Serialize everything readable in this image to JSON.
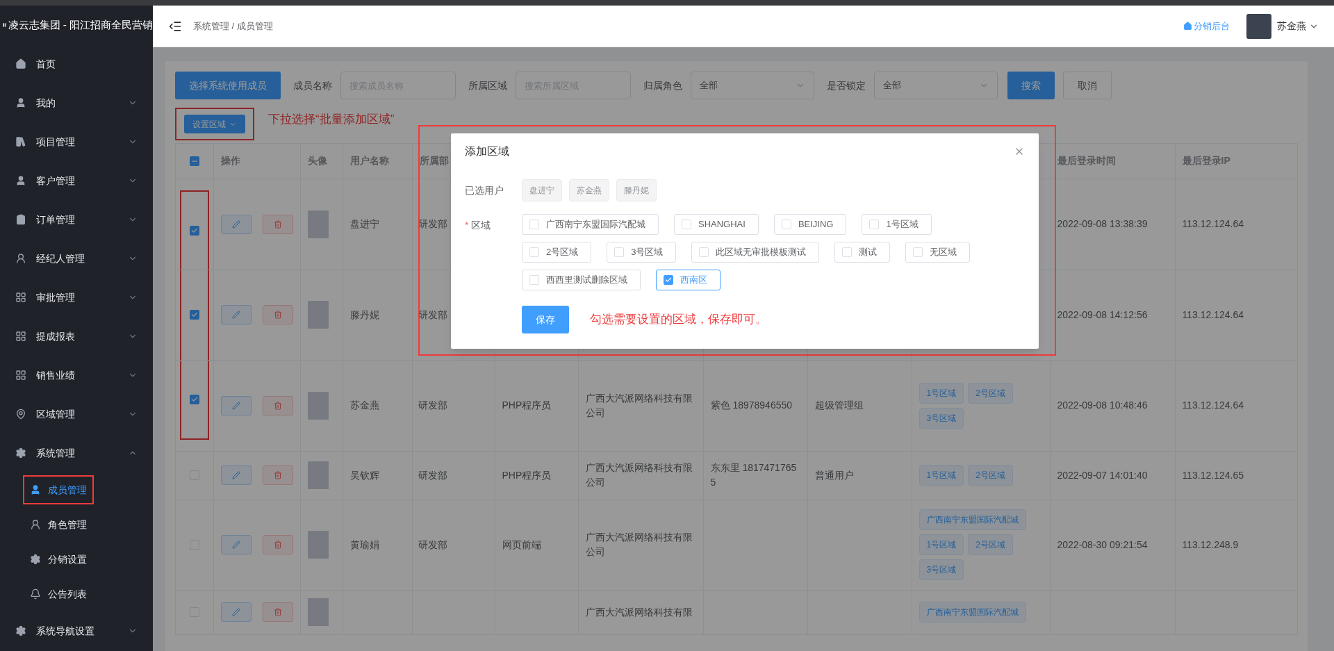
{
  "sidebar": {
    "brand": "凌云志集团 - 阳江招商全民营销",
    "items": [
      {
        "label": "首页"
      },
      {
        "label": "我的",
        "expanded": false
      },
      {
        "label": "项目管理",
        "expanded": false
      },
      {
        "label": "客户管理",
        "expanded": false
      },
      {
        "label": "订单管理",
        "expanded": false
      },
      {
        "label": "经纪人管理",
        "expanded": false
      },
      {
        "label": "审批管理",
        "expanded": false
      },
      {
        "label": "提成报表",
        "expanded": false
      },
      {
        "label": "销售业绩",
        "expanded": false
      },
      {
        "label": "区域管理",
        "expanded": false
      },
      {
        "label": "系统管理",
        "expanded": true,
        "children": [
          {
            "label": "成员管理",
            "selected": true,
            "highlighted": true
          },
          {
            "label": "角色管理",
            "selected": false,
            "highlighted": false
          },
          {
            "label": "分销设置",
            "selected": false,
            "highlighted": false
          },
          {
            "label": "公告列表",
            "selected": false,
            "highlighted": false
          }
        ]
      },
      {
        "label": "系统导航设置",
        "expanded": false
      }
    ]
  },
  "header": {
    "breadcrumb": "系统管理 / 成员管理",
    "link": "分销后台",
    "user": "苏金燕"
  },
  "filters": {
    "primary_button": "选择系统使用成员",
    "fields": [
      {
        "kind": "input",
        "label": "成员名称",
        "placeholder": "搜索成员名称"
      },
      {
        "kind": "input",
        "label": "所属区域",
        "placeholder": "搜索所属区域"
      },
      {
        "kind": "select",
        "label": "归属角色",
        "value": "全部"
      },
      {
        "kind": "select",
        "label": "是否锁定",
        "value": "全部"
      }
    ],
    "search_button": "搜索",
    "cancel_button": "取消"
  },
  "set_region": {
    "label": "设置区域",
    "highlighted": true,
    "note": "下拉选择“批量添加区域”"
  },
  "table": {
    "all_indeterminate": true,
    "columns": [
      "操作",
      "头像",
      "用户名称",
      "所属部",
      "",
      "",
      "",
      "",
      "",
      "最后登录时间",
      "最后登录IP"
    ],
    "rows": [
      {
        "checked": true,
        "highlighted": true,
        "name": "盘进宁",
        "dept": "研发部",
        "time": "2022-09-08 13:38:39",
        "ip": "113.12.124.64"
      },
      {
        "checked": true,
        "highlighted": true,
        "name": "滕丹妮",
        "dept": "研发部",
        "time": "2022-09-08 14:12:56",
        "ip": "113.12.124.64"
      },
      {
        "checked": true,
        "highlighted": true,
        "name": "苏金燕",
        "dept": "研发部",
        "position": "PHP程序员",
        "company": "广西大汽派网络科技有限公司",
        "contact": "紫色 18978946550",
        "role": "超级管理组",
        "regions": [
          "1号区域",
          "2号区域",
          "3号区域"
        ],
        "time": "2022-09-08 10:48:46",
        "ip": "113.12.124.64"
      },
      {
        "checked": false,
        "highlighted": false,
        "name": "吴钦辉",
        "dept": "研发部",
        "position": "PHP程序员",
        "company": "广西大汽派网络科技有限公司",
        "contact": "东东里 18174717655",
        "role": "普通用户",
        "regions": [
          "1号区域",
          "2号区域"
        ],
        "time": "2022-09-07 14:01:40",
        "ip": "113.12.124.65"
      },
      {
        "checked": false,
        "highlighted": false,
        "name": "黄瑜娟",
        "dept": "研发部",
        "position": "网页前端",
        "company": "广西大汽派网络科技有限公司",
        "regions": [
          "广西南宁东盟国际汽配城",
          "1号区域",
          "2号区域",
          "3号区域"
        ],
        "time": "2022-08-30 09:21:54",
        "ip": "113.12.248.9"
      },
      {
        "checked": false,
        "highlighted": false,
        "company": "广西大汽派网络科技有限",
        "regions": [
          "广西南宁东盟国际汽配城"
        ]
      }
    ]
  },
  "modal": {
    "title": "添加区域",
    "highlighted": true,
    "users_label": "已选用户",
    "users": [
      "盘进宁",
      "苏金燕",
      "滕丹妮"
    ],
    "region_label": "区域",
    "required_mark": "*",
    "regions": [
      {
        "label": "广西南宁东盟国际汽配城",
        "checked": false
      },
      {
        "label": "SHANGHAI",
        "checked": false
      },
      {
        "label": "BEIJING",
        "checked": false
      },
      {
        "label": "1号区域",
        "checked": false
      },
      {
        "label": "2号区域",
        "checked": false
      },
      {
        "label": "3号区域",
        "checked": false
      },
      {
        "label": "此区域无审批模板测试",
        "checked": false
      },
      {
        "label": "测试",
        "checked": false
      },
      {
        "label": "无区域",
        "checked": false
      },
      {
        "label": "西西里测试删除区域",
        "checked": false
      },
      {
        "label": "西南区",
        "checked": true
      }
    ],
    "save_button": "保存",
    "note": "勾选需要设置的区域，保存即可。"
  }
}
